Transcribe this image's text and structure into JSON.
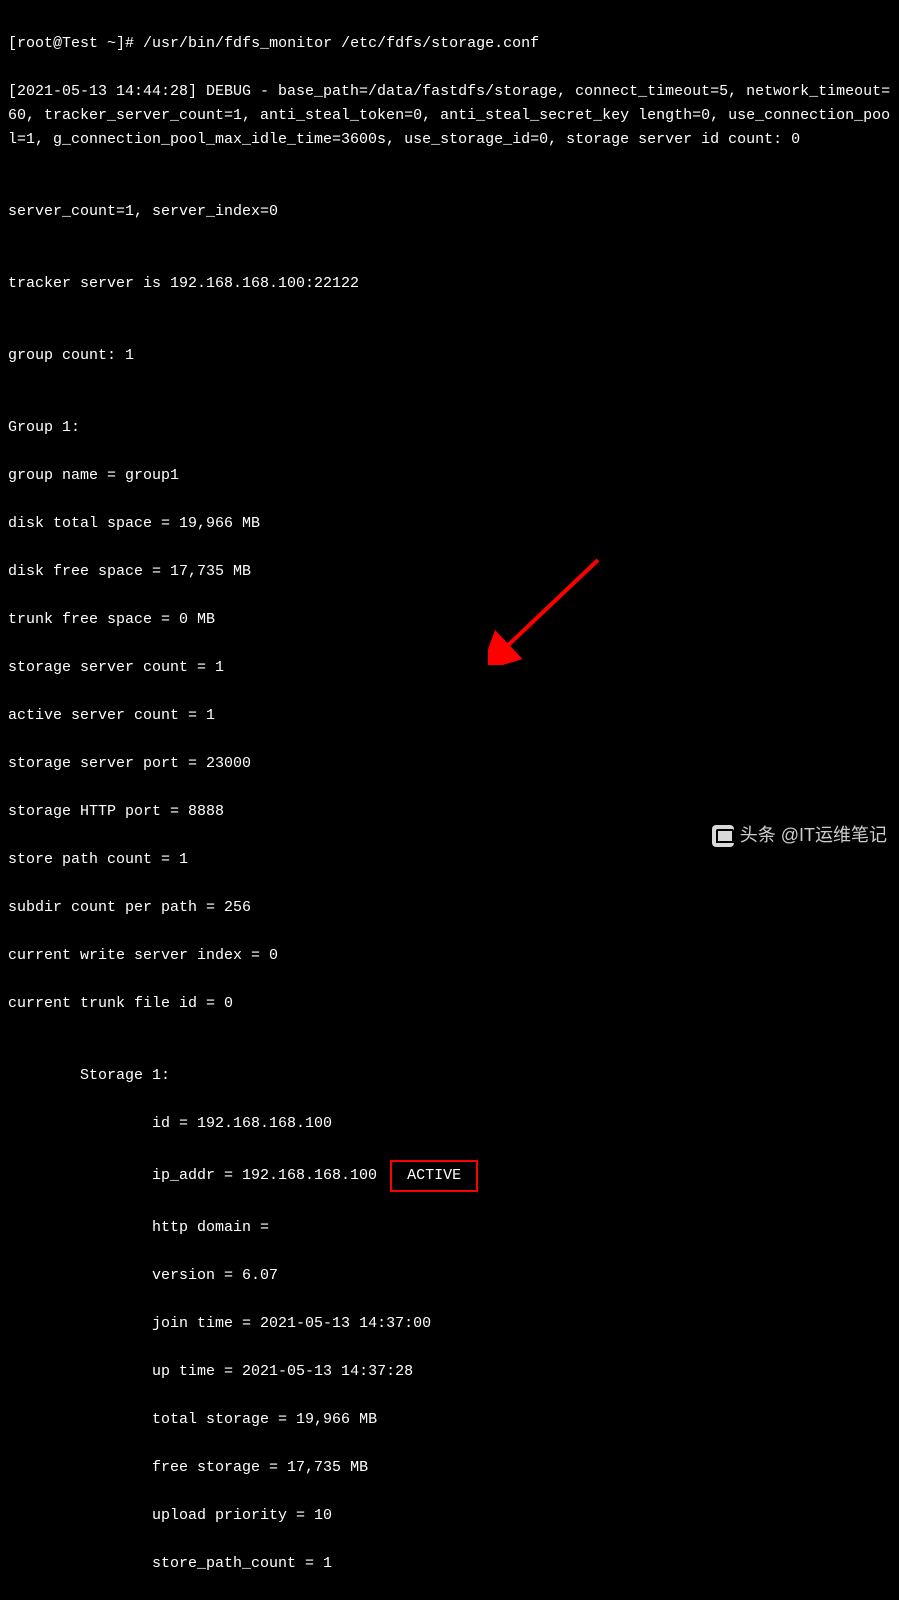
{
  "prompt": {
    "user_host": "[root@Test ~]#",
    "command": "/usr/bin/fdfs_monitor /etc/fdfs/storage.conf"
  },
  "output": {
    "debug_line": "[2021-05-13 14:44:28] DEBUG - base_path=/data/fastdfs/storage, connect_timeout=5, network_timeout=60, tracker_server_count=1, anti_steal_token=0, anti_steal_secret_key length=0, use_connection_pool=1, g_connection_pool_max_idle_time=3600s, use_storage_id=0, storage server id count: 0",
    "blank1": "",
    "server_count": "server_count=1, server_index=0",
    "blank2": "",
    "tracker_server": "tracker server is 192.168.168.100:22122",
    "blank3": "",
    "group_count": "group count: 1",
    "blank4": "",
    "group_header": "Group 1:",
    "group_name": "group name = group1",
    "disk_total": "disk total space = 19,966 MB",
    "disk_free": "disk free space = 17,735 MB",
    "trunk_free": "trunk free space = 0 MB",
    "storage_server_count": "storage server count = 1",
    "active_server_count": "active server count = 1",
    "storage_server_port": "storage server port = 23000",
    "storage_http_port": "storage HTTP port = 8888",
    "store_path_count": "store path count = 1",
    "subdir_count": "subdir count per path = 256",
    "current_write_server": "current write server index = 0",
    "current_trunk_file": "current trunk file id = 0",
    "blank5": "",
    "storage_header": "        Storage 1:",
    "storage_id": "                id = 192.168.168.100",
    "storage_ip_prefix": "                ip_addr = 192.168.168.100 ",
    "storage_active": " ACTIVE ",
    "http_domain": "                http domain = ",
    "version": "                version = 6.07",
    "join_time": "                join time = 2021-05-13 14:37:00",
    "up_time": "                up time = 2021-05-13 14:37:28",
    "total_storage": "                total storage = 19,966 MB",
    "free_storage": "                free storage = 17,735 MB",
    "upload_priority": "                upload priority = 10",
    "store_path_count2": "                store_path_count = 1"
  },
  "watermark": {
    "text": "头条 @IT运维笔记"
  }
}
